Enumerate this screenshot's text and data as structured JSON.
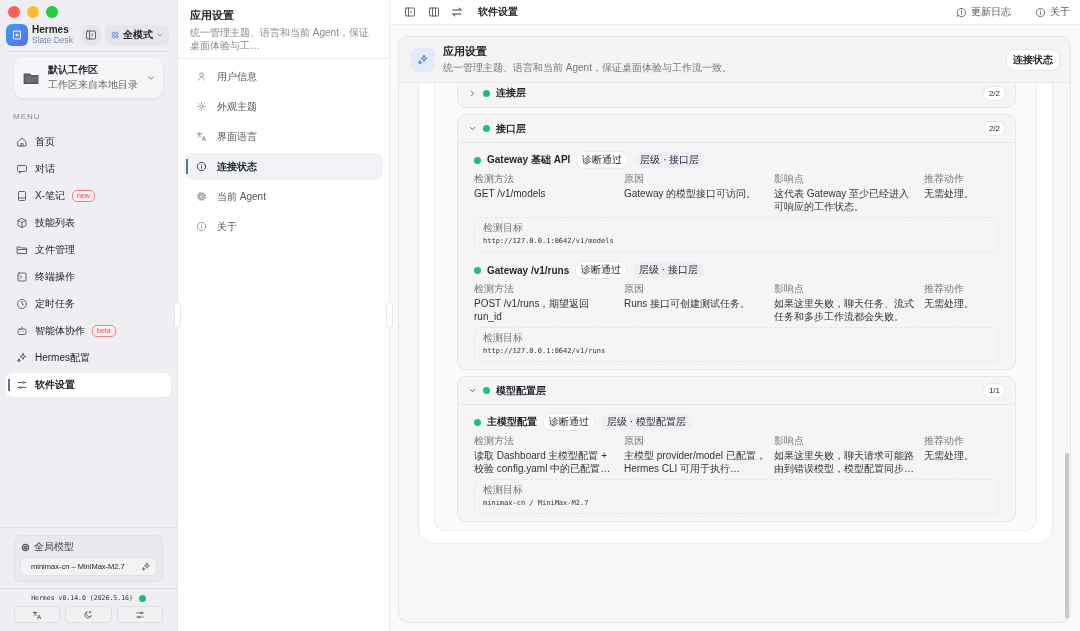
{
  "sidebar": {
    "app": {
      "name": "Hermes",
      "subtitle": "Slate Desk"
    },
    "mode_button": "全模式",
    "workspace": {
      "name": "默认工作区",
      "source": "工作区来自本地目录"
    },
    "menu_heading": "MENU",
    "items": [
      {
        "label": "首页",
        "selected": false
      },
      {
        "label": "对话",
        "selected": false
      },
      {
        "label": "X-笔记",
        "badge": "new",
        "selected": false
      },
      {
        "label": "技能列表",
        "selected": false
      },
      {
        "label": "文件管理",
        "selected": false
      },
      {
        "label": "终端操作",
        "selected": false
      },
      {
        "label": "定时任务",
        "selected": false
      },
      {
        "label": "智能体协作",
        "badge": "beta",
        "selected": false
      },
      {
        "label": "Hermes配置",
        "selected": false
      },
      {
        "label": "软件设置",
        "selected": true
      }
    ],
    "global_model": {
      "label": "全局模型",
      "value": "minimax-cn – MiniMax-M2.7"
    },
    "version": "Hermes v0.14.0 (2026.5.16)",
    "online": true
  },
  "settings_nav": {
    "title": "应用设置",
    "subtitle": "统一管理主题、语言和当前 Agent，保证桌面体验与工…",
    "items": [
      {
        "label": "用户信息",
        "selected": false
      },
      {
        "label": "外观主题",
        "selected": false
      },
      {
        "label": "界面语言",
        "selected": false
      },
      {
        "label": "连接状态",
        "selected": true
      },
      {
        "label": "当前 Agent",
        "selected": false
      },
      {
        "label": "关于",
        "selected": false
      }
    ]
  },
  "topbar": {
    "title": "软件设置",
    "links": [
      "更新日志",
      "关于"
    ]
  },
  "panel": {
    "title": "应用设置",
    "subtitle": "统一管理主题、语言和当前 Agent，保证桌面体验与工作流一致。",
    "tag": "连接状态",
    "groups": [
      {
        "title": "连接层",
        "count": "2/2",
        "passed": true,
        "expanded": false
      },
      {
        "title": "接口层",
        "count": "2/2",
        "passed": true,
        "expanded": true,
        "checks": [
          {
            "name": "Gateway 基础 API",
            "passed": true,
            "status": "诊断通过",
            "level_tag": "层级 · 接口层",
            "fields": [
              {
                "label": "检测方法",
                "value": "GET /v1/models"
              },
              {
                "label": "原因",
                "value": "Gateway 的模型接口可访问。"
              },
              {
                "label": "影响点",
                "value": "这代表 Gateway 至少已经进入可响应的工作状态。"
              },
              {
                "label": "推荐动作",
                "value": "无需处理。"
              }
            ],
            "target": {
              "label": "检测目标",
              "value": "http://127.0.0.1:8642/v1/models"
            }
          },
          {
            "name": "Gateway /v1/runs",
            "passed": true,
            "status": "诊断通过",
            "level_tag": "层级 · 接口层",
            "fields": [
              {
                "label": "检测方法",
                "value": "POST /v1/runs，期望返回 run_id"
              },
              {
                "label": "原因",
                "value": "Runs 接口可创建测试任务。"
              },
              {
                "label": "影响点",
                "value": "如果这里失败，聊天任务、流式任务和多步工作流都会失败。"
              },
              {
                "label": "推荐动作",
                "value": "无需处理。"
              }
            ],
            "target": {
              "label": "检测目标",
              "value": "http://127.0.0.1:8642/v1/runs"
            }
          }
        ]
      },
      {
        "title": "模型配置层",
        "count": "1/1",
        "passed": true,
        "expanded": true,
        "checks": [
          {
            "name": "主模型配置",
            "passed": true,
            "status": "诊断通过",
            "level_tag": "层级 · 模型配置层",
            "fields": [
              {
                "label": "检测方法",
                "value": "读取 Dashboard 主模型配置 + 校验 config.yaml 中的已配置…"
              },
              {
                "label": "原因",
                "value": "主模型 provider/model 已配置，Hermes CLI 可用于执行…"
              },
              {
                "label": "影响点",
                "value": "如果这里失败，聊天请求可能路由到错误模型，模型配置同步…"
              },
              {
                "label": "推荐动作",
                "value": "无需处理。"
              }
            ],
            "target": {
              "label": "检测目标",
              "value": "minimax-cn / MiniMax-M2.7"
            }
          }
        ]
      }
    ]
  }
}
